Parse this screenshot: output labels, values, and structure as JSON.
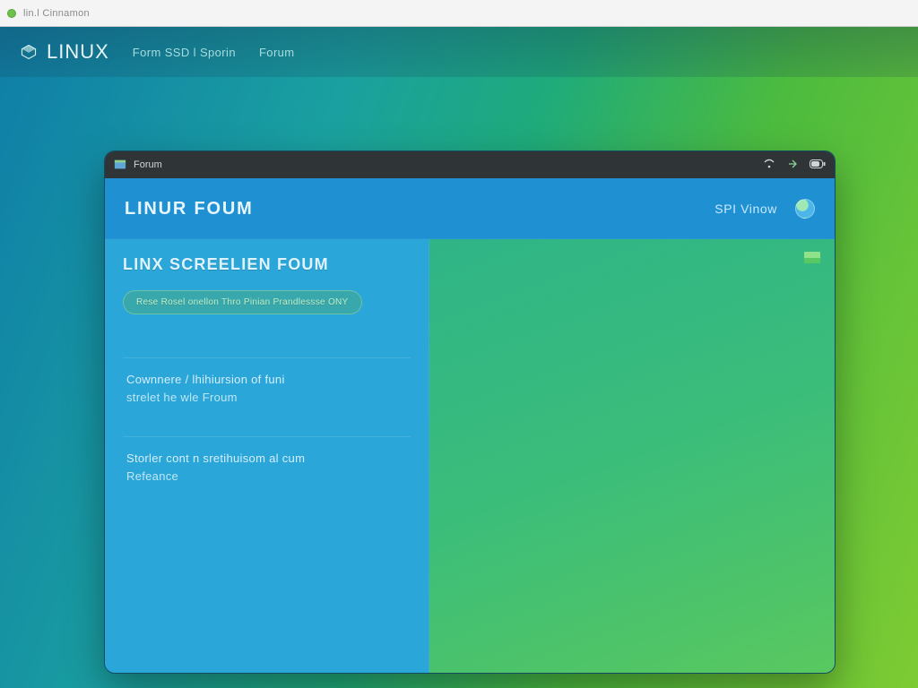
{
  "browser": {
    "tab_label": "lin.l Cinnamon"
  },
  "header": {
    "brand": "Linux",
    "crumb1": "Form SSD l Sporin",
    "crumb2": "Forum"
  },
  "window": {
    "title": "Forum",
    "app_title": "LINUR FOUM",
    "right_label": "SPI Vinow"
  },
  "left": {
    "section_title": "LINX SCREELIEN FOUM",
    "pill": "Rese Rosel onellon   Thro Pinian Prandlessse ONY",
    "entries": [
      {
        "l1": "Cownnere / lhihiursion of funi",
        "l2": "strelet he wle Froum"
      },
      {
        "l1": "Storler cont n sretihuisom al cum",
        "l2": "Refeance"
      }
    ]
  }
}
